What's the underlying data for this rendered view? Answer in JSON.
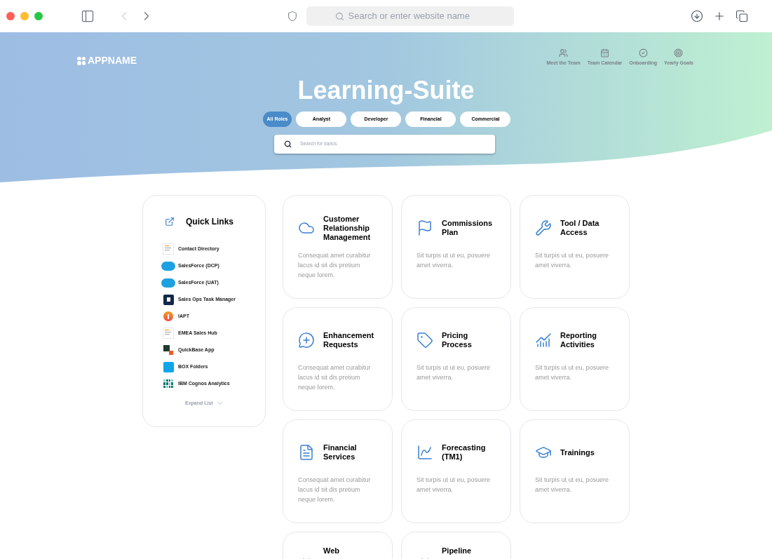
{
  "browser": {
    "address_placeholder": "Search or enter website name"
  },
  "header": {
    "logo": "APPNAME",
    "nav": [
      {
        "label": "Meet the Team",
        "kind": "team"
      },
      {
        "label": "Team Calendar",
        "kind": "calendar"
      },
      {
        "label": "Onboarding",
        "kind": "onboarding"
      },
      {
        "label": "Yearly Goals",
        "kind": "goals"
      }
    ]
  },
  "title": "Learning-Suite",
  "filters": [
    {
      "label": "All Roles",
      "selected": true
    },
    {
      "label": "Analyst",
      "selected": false
    },
    {
      "label": "Developer",
      "selected": false
    },
    {
      "label": "Financial",
      "selected": false
    },
    {
      "label": "Commercial",
      "selected": false
    }
  ],
  "search": {
    "placeholder": "Search for topics"
  },
  "quick_links": {
    "title": "Quick Links",
    "items": [
      {
        "label": "Contact Directory",
        "kind": "doc"
      },
      {
        "label": "SalesForce (DCP)",
        "kind": "cloud"
      },
      {
        "label": "SalesForce (UAT)",
        "kind": "cloud"
      },
      {
        "label": "Sales Ops Task Manager",
        "kind": "task"
      },
      {
        "label": "IAPT",
        "kind": "info"
      },
      {
        "label": "EMEA Sales Hub",
        "kind": "doc"
      },
      {
        "label": "QuickBase App",
        "kind": "cube"
      },
      {
        "label": "BOX Folders",
        "kind": "box"
      },
      {
        "label": "IBM Cognos Analytics",
        "kind": "dots"
      }
    ],
    "expand": "Expand List"
  },
  "cards": [
    {
      "title": "Customer Relationship Management",
      "description": "Consequat amet curabitur lacus id sit dis pretium neque lorem.",
      "kind": "cloud"
    },
    {
      "title": "Commissions Plan",
      "description": "Sit turpis ut ut eu, posuere amet viverra.",
      "kind": "flag"
    },
    {
      "title": "Tool / Data Access",
      "description": "Sit turpis ut ut eu, posuere amet viverra.",
      "kind": "tools"
    },
    {
      "title": "Enhancement Requests",
      "description": "Consequat amet curabitur lacus id sit dis pretium neque lorem.",
      "kind": "message"
    },
    {
      "title": "Pricing Process",
      "description": "Sit turpis ut ut eu, posuere amet viverra.",
      "kind": "tag"
    },
    {
      "title": "Reporting Activities",
      "description": "Sit turpis ut ut eu, posuere amet viverra.",
      "kind": "chart"
    },
    {
      "title": "Financial Services",
      "description": "Consequat amet curabitur lacus id sit dis pretium neque lorem.",
      "kind": "invoice"
    },
    {
      "title": "Forecasting (TM1)",
      "description": "Sit turpis ut ut eu, posuere amet viverra.",
      "kind": "forecast"
    },
    {
      "title": "Trainings",
      "description": "Sit turpis ut ut eu, posuere amet viverra.",
      "kind": "graduation"
    },
    {
      "title": "Web",
      "kind": "code"
    },
    {
      "title": "Pipeline",
      "kind": "code"
    }
  ]
}
